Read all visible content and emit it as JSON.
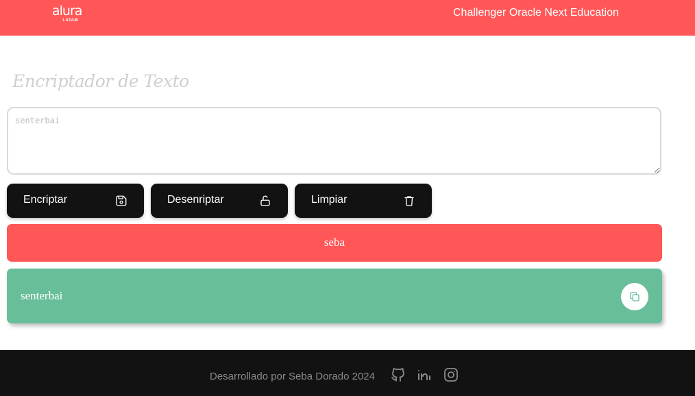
{
  "header": {
    "logo_text": "alura",
    "logo_sub": "LATAM",
    "title": "Challenger Oracle Next Education"
  },
  "main": {
    "title": "Encriptador de Texto",
    "input": {
      "placeholder": "senterbai",
      "value": ""
    },
    "buttons": {
      "encrypt": {
        "label": "Encriptar",
        "icon": "save-icon"
      },
      "decrypt": {
        "label": "Desenriptar",
        "icon": "unlock-icon"
      },
      "clear": {
        "label": "Limpiar",
        "icon": "trash-icon"
      }
    },
    "result_primary": "seba",
    "result_secondary": "senterbai",
    "copy_icon": "copy-icon"
  },
  "footer": {
    "text": "Desarrollado por Seba Dorado 2024",
    "icons": [
      "github-icon",
      "linkedin-icon",
      "instagram-icon"
    ]
  },
  "colors": {
    "accent": "#ff5757",
    "dark": "#121212",
    "success": "#69be9a"
  }
}
